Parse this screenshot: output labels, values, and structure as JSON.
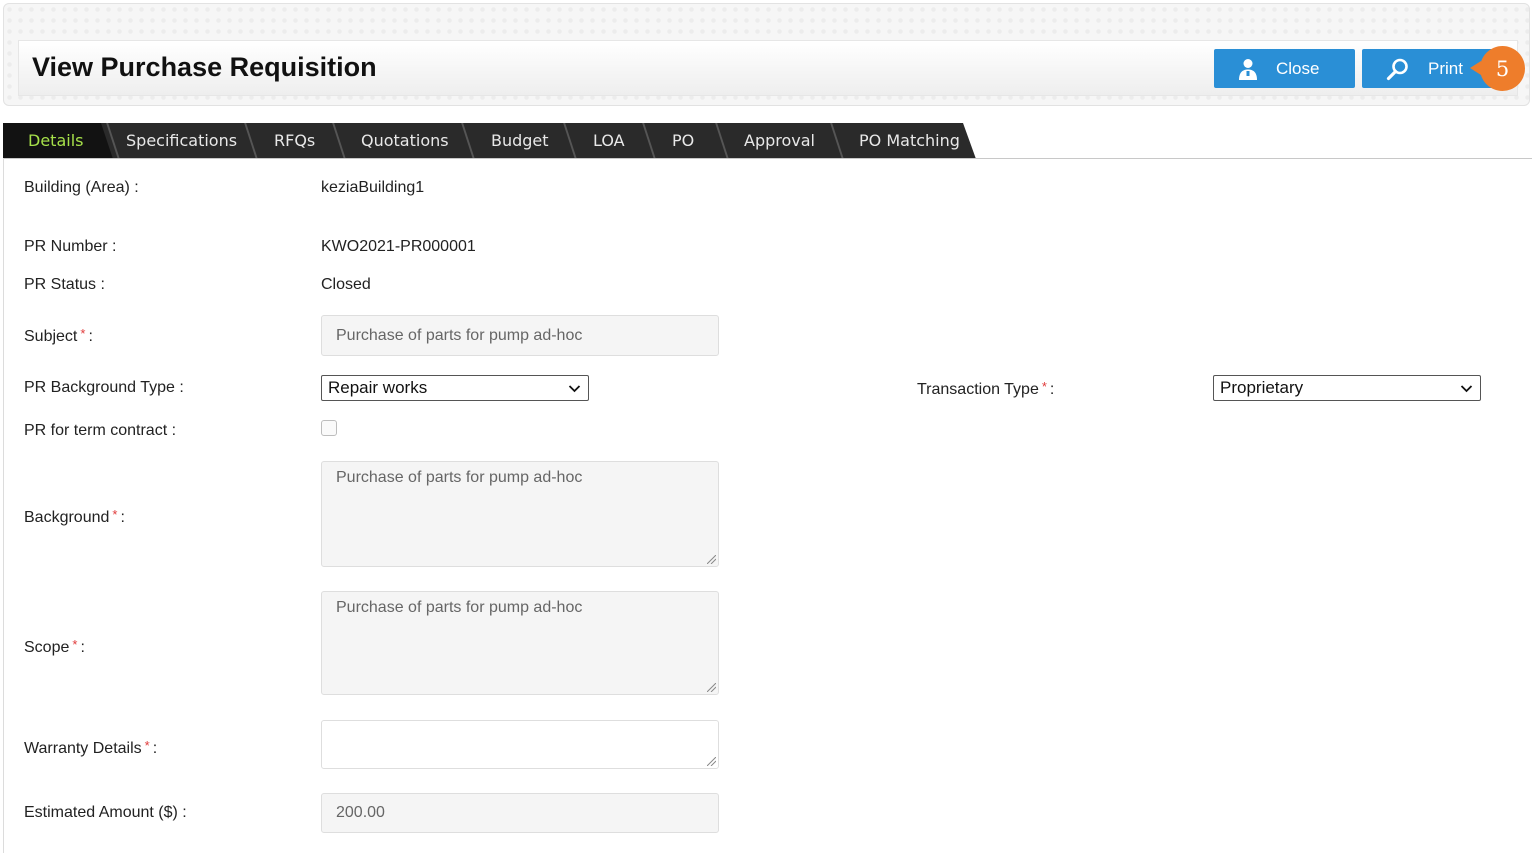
{
  "header": {
    "title": "View Purchase Requisition",
    "close_label": "Close",
    "print_label": "Print",
    "step_number": "5",
    "accent_color": "#2a8fd6",
    "badge_color": "#ee7d2b"
  },
  "tabs": [
    {
      "label": "Details",
      "active": true
    },
    {
      "label": "Specifications"
    },
    {
      "label": "RFQs"
    },
    {
      "label": "Quotations"
    },
    {
      "label": "Budget"
    },
    {
      "label": "LOA"
    },
    {
      "label": "PO"
    },
    {
      "label": "Approval"
    },
    {
      "label": "PO Matching"
    }
  ],
  "form": {
    "building_label": "Building (Area) :",
    "building_value": "keziaBuilding1",
    "pr_number_label": "PR Number :",
    "pr_number_value": "KWO2021-PR000001",
    "pr_status_label": "PR Status :",
    "pr_status_value": "Closed",
    "subject_label": "Subject",
    "subject_value": "Purchase of parts for pump ad-hoc",
    "bg_type_label": "PR Background Type :",
    "bg_type_value": "Repair works",
    "transaction_type_label": "Transaction Type",
    "transaction_type_value": "Proprietary",
    "term_contract_label": "PR for term contract :",
    "term_contract_checked": false,
    "background_label": "Background",
    "background_value": "Purchase of parts for pump ad-hoc",
    "scope_label": "Scope",
    "scope_value": "Purchase of parts for pump ad-hoc",
    "warranty_label": "Warranty Details",
    "warranty_value": "",
    "amount_label": "Estimated Amount ($) :",
    "amount_value": "200.00",
    "required_mark": "*",
    "colon": ":"
  }
}
